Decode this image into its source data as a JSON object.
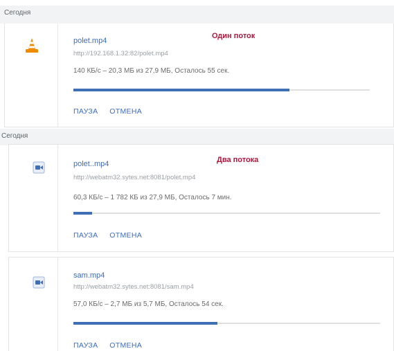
{
  "sections": [
    {
      "header": "Сегодня"
    },
    {
      "header": "Сегодня"
    }
  ],
  "notes": {
    "one_stream": "Один поток",
    "two_streams": "Два потока"
  },
  "downloads": [
    {
      "icon": "vlc-cone-icon",
      "name": "polet.mp4",
      "url": "http://192.168.1.32:82/polet.mp4",
      "status": "140 КБ/с – 20,3 МБ из 27,9 МБ, Осталось 55 сек.",
      "progress": 0.73,
      "pause": "ПАУЗА",
      "cancel": "ОТМЕНА"
    },
    {
      "icon": "video-file-icon",
      "name": "polet..mp4",
      "url": "http://webatm32.sytes.net:8081/polet.mp4",
      "status": "60,3 КБ/с – 1 782 КБ из 27,9 МБ, Осталось 7 мин.",
      "progress": 0.06,
      "pause": "ПАУЗА",
      "cancel": "ОТМЕНА"
    },
    {
      "icon": "video-file-icon",
      "name": "sam.mp4",
      "url": "http://webatm32.sytes.net:8081/sam.mp4",
      "status": "57,0 КБ/с – 2,7 МБ из 5,7 МБ, Осталось 54 сек.",
      "progress": 0.47,
      "pause": "ПАУЗА",
      "cancel": "ОТМЕНА"
    }
  ]
}
